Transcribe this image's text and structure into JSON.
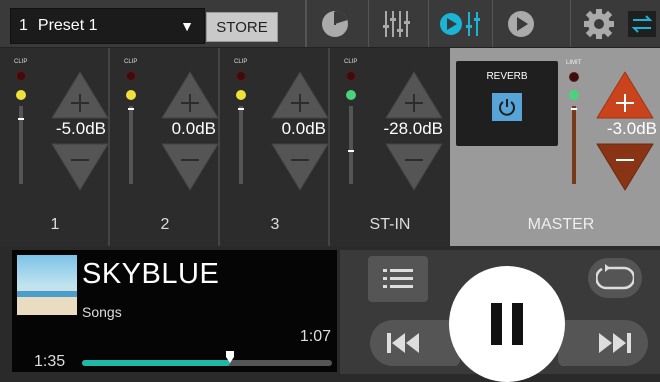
{
  "topbar": {
    "preset_number": "1",
    "preset_name": "Preset 1",
    "preset_arrow": "▼",
    "store_label": "STORE",
    "icons": [
      "meter-icon",
      "mixer-faders-icon",
      "play-eq-icon",
      "play-icon",
      "gear-icon",
      "swap-icon"
    ],
    "active_color": "#1ab5d6"
  },
  "channels": [
    {
      "name": "1",
      "clip_label": "CLIP",
      "level": "-5.0dB",
      "led": "yellow"
    },
    {
      "name": "2",
      "clip_label": "CLIP",
      "level": "0.0dB",
      "led": "yellow"
    },
    {
      "name": "3",
      "clip_label": "CLIP",
      "level": "0.0dB",
      "led": "yellow"
    },
    {
      "name": "ST-IN",
      "clip_label": "CLIP",
      "level": "-28.0dB",
      "led": "green"
    }
  ],
  "master": {
    "name": "MASTER",
    "reverb_label": "REVERB",
    "limit_label": "LIMIT",
    "level": "-3.0dB",
    "up_color": "#c9431d",
    "down_color": "#8a3416"
  },
  "player": {
    "title": "SKYBLUE",
    "subtitle": "Songs",
    "remaining": "1:07",
    "elapsed": "1:35",
    "progress": 0.59,
    "seek_color": "#1fb7a6"
  },
  "transport": {
    "icons": [
      "list-icon",
      "repeat-icon",
      "previous-icon",
      "pause-icon",
      "next-icon"
    ]
  }
}
